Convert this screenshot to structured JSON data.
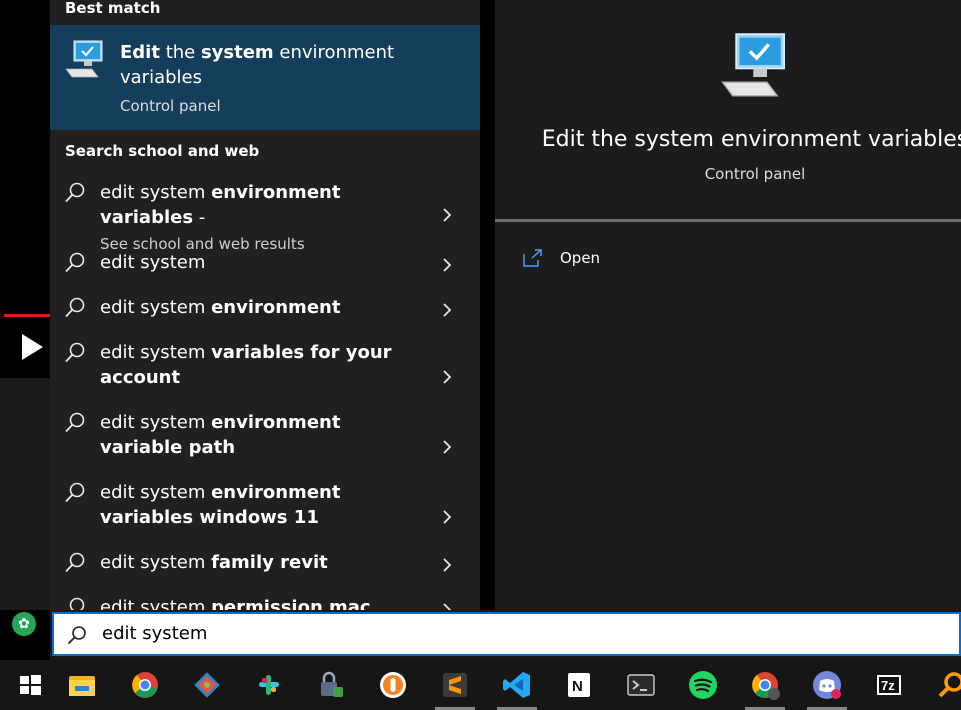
{
  "results": {
    "best_match_title": "Best match",
    "best_match": {
      "title_parts": [
        {
          "t": "Edit",
          "b": true
        },
        {
          "t": " the ",
          "b": false
        },
        {
          "t": "system",
          "b": true
        },
        {
          "t": " environment variables",
          "b": false
        }
      ],
      "subtitle": "Control panel"
    },
    "web_title": "Search school and web",
    "suggestions": [
      {
        "parts": [
          {
            "t": "edit system ",
            "b": false
          },
          {
            "t": "environment variables",
            "b": true
          },
          {
            "t": " -",
            "b": false
          }
        ],
        "sub": "See school and web results"
      },
      {
        "parts": [
          {
            "t": "edit system",
            "b": false
          }
        ]
      },
      {
        "parts": [
          {
            "t": "edit system ",
            "b": false
          },
          {
            "t": "environment",
            "b": true
          }
        ]
      },
      {
        "parts": [
          {
            "t": "edit system ",
            "b": false
          },
          {
            "t": "variables for your account",
            "b": true
          }
        ]
      },
      {
        "parts": [
          {
            "t": "edit system ",
            "b": false
          },
          {
            "t": "environment variable path",
            "b": true
          }
        ]
      },
      {
        "parts": [
          {
            "t": "edit system ",
            "b": false
          },
          {
            "t": "environment variables windows 11",
            "b": true
          }
        ]
      },
      {
        "parts": [
          {
            "t": "edit system ",
            "b": false
          },
          {
            "t": "family revit",
            "b": true
          }
        ]
      },
      {
        "parts": [
          {
            "t": "edit system ",
            "b": false
          },
          {
            "t": "permission mac",
            "b": true
          }
        ]
      }
    ]
  },
  "detail": {
    "title": "Edit the system environment variables",
    "subtitle": "Control panel",
    "open_label": "Open"
  },
  "search": {
    "query": "edit system"
  },
  "taskbar": {
    "items": [
      {
        "name": "start-icon",
        "color": "#ffffff"
      },
      {
        "name": "file-explorer-icon",
        "color": "#f2b31b"
      },
      {
        "name": "chrome-icon",
        "color": "#db4437"
      },
      {
        "name": "git-icon",
        "color": "#e9553b"
      },
      {
        "name": "slack-icon",
        "color": "#e01e5a"
      },
      {
        "name": "keepass-icon",
        "color": "#3aa34a"
      },
      {
        "name": "vpn-icon",
        "color": "#f58220"
      },
      {
        "name": "sublime-icon",
        "color": "#ff9800"
      },
      {
        "name": "vscode-icon",
        "color": "#23a9f2"
      },
      {
        "name": "notion-icon",
        "color": "#ffffff"
      },
      {
        "name": "terminal-icon",
        "color": "#cccccc"
      },
      {
        "name": "spotify-icon",
        "color": "#1ed760"
      },
      {
        "name": "chrome-profile-icon",
        "color": "#db4437"
      },
      {
        "name": "discord-icon",
        "color": "#7289da"
      },
      {
        "name": "7zip-icon",
        "color": "#ffffff"
      },
      {
        "name": "search-app-icon",
        "color": "#ff9a00"
      }
    ],
    "sevenzip_label": "7z"
  }
}
